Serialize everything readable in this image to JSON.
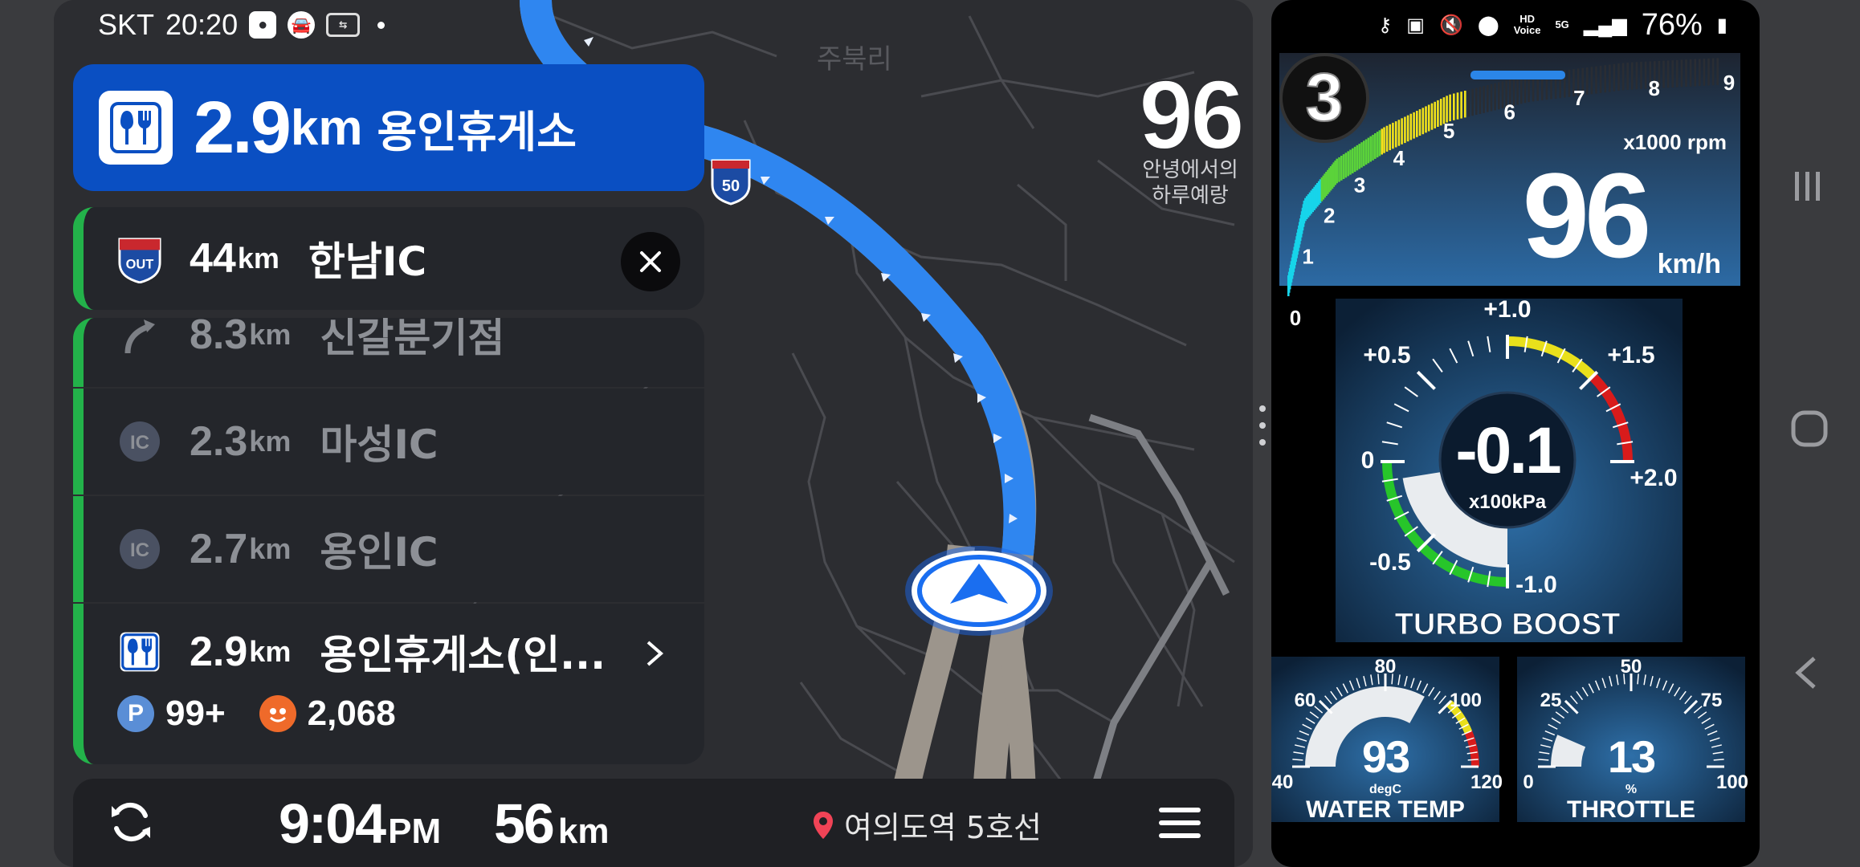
{
  "status_left": {
    "carrier": "SKT",
    "time": "20:20"
  },
  "next_turn": {
    "icon": "restaurant-icon",
    "distance": "2.9",
    "unit": "km",
    "name": "용인휴게소"
  },
  "map": {
    "place_label": "주북리",
    "route_shield": "50"
  },
  "speed_overlay": {
    "value": "96",
    "caption_line1": "안녕에서의",
    "caption_line2": "하루예랑"
  },
  "guide_list": [
    {
      "icon": "highway-exit-out-icon",
      "distance": "44",
      "unit": "km",
      "name": "한남IC"
    },
    {
      "icon": "branch-junction-icon",
      "distance": "8.3",
      "unit": "km",
      "name": "신갈분기점"
    },
    {
      "icon": "ic-badge-icon",
      "badge": "IC",
      "distance": "2.3",
      "unit": "km",
      "name": "마성IC"
    },
    {
      "icon": "ic-badge-icon",
      "badge": "IC",
      "distance": "2.7",
      "unit": "km",
      "name": "용인IC"
    },
    {
      "icon": "restaurant-icon",
      "distance": "2.9",
      "unit": "km",
      "name": "용인휴게소(인...",
      "parking_badge": "P",
      "parking": "99+",
      "price": "2,068"
    }
  ],
  "exit_badge": "OUT",
  "bottom_bar": {
    "eta_time": "9:04",
    "eta_ampm": "PM",
    "remaining": "56",
    "remaining_unit": "km",
    "destination": "여의도역 5호선"
  },
  "status_right": {
    "hd_top": "HD",
    "hd_bottom": "Voice",
    "network": "5G",
    "battery": "76%"
  },
  "tacho": {
    "gear": "3",
    "rpm_value": 5.4,
    "rpm_max": 9,
    "rpm_ticks": [
      "0",
      "1",
      "2",
      "3",
      "4",
      "5",
      "6",
      "7",
      "8",
      "9"
    ],
    "rpm_unit": "x1000 rpm",
    "speed": "96",
    "speed_unit": "km/h"
  },
  "boost": {
    "value": -0.1,
    "value_text": "-0.1",
    "unit": "x100kPa",
    "title": "TURBO BOOST",
    "ticks": [
      "-1.0",
      "-0.5",
      "0",
      "+0.5",
      "+1.0",
      "+1.5",
      "+2.0"
    ]
  },
  "water_temp": {
    "value": 93,
    "value_text": "93",
    "unit": "degC",
    "title": "WATER TEMP",
    "ticks": [
      "40",
      "60",
      "80",
      "100",
      "120"
    ]
  },
  "throttle": {
    "value": 13,
    "value_text": "13",
    "unit": "%",
    "title": "THROTTLE",
    "ticks": [
      "0",
      "25",
      "50",
      "75",
      "100"
    ]
  },
  "colors": {
    "route_blue": "#2f86f0",
    "guide_blue": "#0a4fc2",
    "accent_green": "#23b24a",
    "rpm_cyan": "#17d4ea",
    "rpm_yellow": "#f3e31b",
    "redline": "#d81b1b"
  }
}
